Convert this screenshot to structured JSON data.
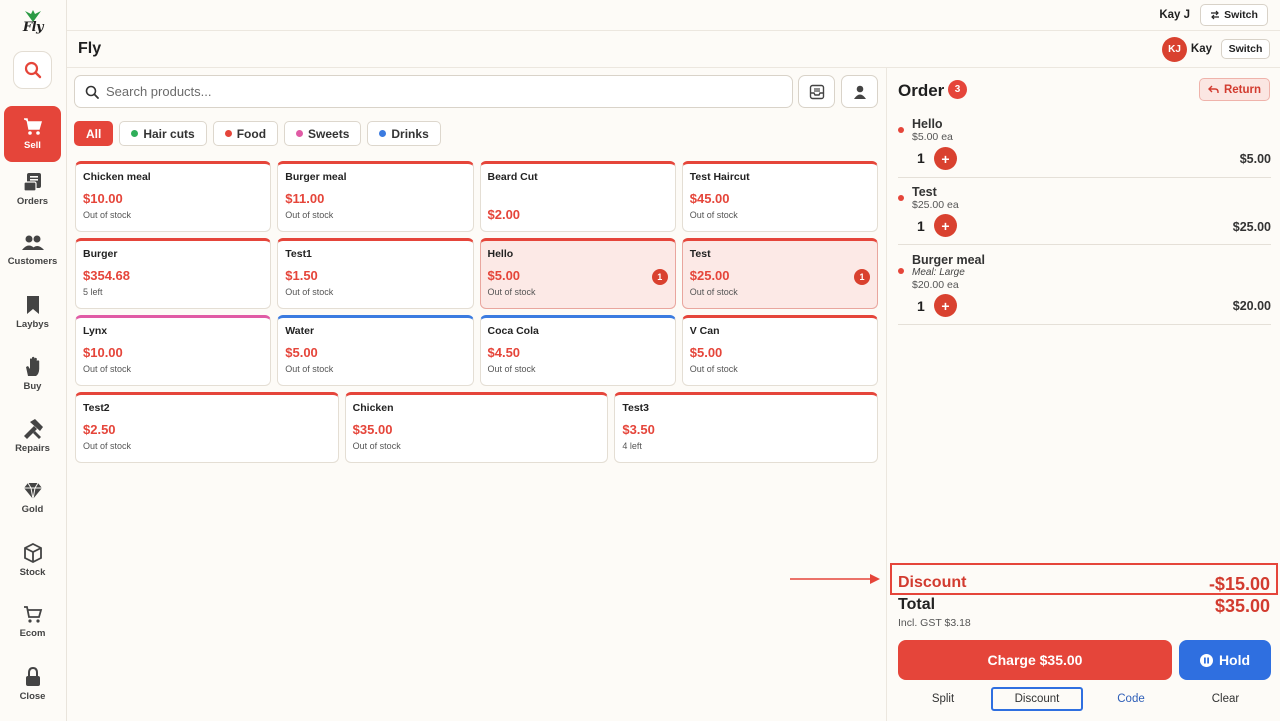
{
  "app": {
    "brand": "Fly",
    "title": "Fly",
    "accent": "#e5453a",
    "blue": "#2f6fe0"
  },
  "topbar": {
    "user_label": "Kay J",
    "switch_label": "Switch"
  },
  "header": {
    "avatar_initials": "KJ",
    "user_name": "Kay",
    "switch_label": "Switch"
  },
  "sidebar": {
    "items": [
      {
        "label": "Sell",
        "icon": "cart-icon",
        "active": true
      },
      {
        "label": "Orders",
        "icon": "orders-icon"
      },
      {
        "label": "Customers",
        "icon": "customers-icon"
      },
      {
        "label": "Laybys",
        "icon": "bookmark-icon"
      },
      {
        "label": "Buy",
        "icon": "hand-icon"
      },
      {
        "label": "Repairs",
        "icon": "tools-icon"
      },
      {
        "label": "Gold",
        "icon": "diamond-icon"
      },
      {
        "label": "Stock",
        "icon": "box-icon"
      },
      {
        "label": "Ecom",
        "icon": "ecom-cart-icon"
      },
      {
        "label": "Close",
        "icon": "lock-icon"
      }
    ]
  },
  "search": {
    "placeholder": "Search products..."
  },
  "categories": [
    {
      "label": "All",
      "active": true
    },
    {
      "label": "Hair cuts",
      "color": "#2fae5a"
    },
    {
      "label": "Food",
      "color": "#e5453a"
    },
    {
      "label": "Sweets",
      "color": "#e05ba5"
    },
    {
      "label": "Drinks",
      "color": "#3b7be0"
    }
  ],
  "products": [
    [
      {
        "name": "Chicken meal",
        "price": "$10.00",
        "stock": "Out of stock",
        "bar": "#e5453a"
      },
      {
        "name": "Burger meal",
        "price": "$11.00",
        "stock": "Out of stock",
        "bar": "#e5453a"
      },
      {
        "name": "Beard Cut",
        "price": "$2.00",
        "stock": "",
        "bar": "#e5453a"
      },
      {
        "name": "Test Haircut",
        "price": "$45.00",
        "stock": "Out of stock",
        "bar": "#e5453a"
      }
    ],
    [
      {
        "name": "Burger",
        "price": "$354.68",
        "stock": "5 left",
        "bar": "#e5453a"
      },
      {
        "name": "Test1",
        "price": "$1.50",
        "stock": "Out of stock",
        "bar": "#e5453a"
      },
      {
        "name": "Hello",
        "price": "$5.00",
        "stock": "Out of stock",
        "bar": "#e5453a",
        "qty": "1"
      },
      {
        "name": "Test",
        "price": "$25.00",
        "stock": "Out of stock",
        "bar": "#e5453a",
        "qty": "1"
      }
    ],
    [
      {
        "name": "Lynx",
        "price": "$10.00",
        "stock": "Out of stock",
        "bar": "#e05ba5"
      },
      {
        "name": "Water",
        "price": "$5.00",
        "stock": "Out of stock",
        "bar": "#3b7be0"
      },
      {
        "name": "Coca Cola",
        "price": "$4.50",
        "stock": "Out of stock",
        "bar": "#3b7be0"
      },
      {
        "name": "V Can",
        "price": "$5.00",
        "stock": "Out of stock",
        "bar": "#e5453a"
      }
    ],
    [
      {
        "name": "Test2",
        "price": "$2.50",
        "stock": "Out of stock",
        "bar": "#e5453a"
      },
      {
        "name": "Chicken",
        "price": "$35.00",
        "stock": "Out of stock",
        "bar": "#e5453a"
      },
      {
        "name": "Test3",
        "price": "$3.50",
        "stock": "4 left",
        "bar": "#e5453a"
      }
    ]
  ],
  "order": {
    "title": "Order",
    "count": "3",
    "return_label": "Return",
    "lines": [
      {
        "name": "Hello",
        "each": "$5.00 ea",
        "qty": "1",
        "total": "$5.00"
      },
      {
        "name": "Test",
        "each": "$25.00 ea",
        "qty": "1",
        "total": "$25.00"
      },
      {
        "name": "Burger meal",
        "modifier": "Meal: Large",
        "each": "$20.00 ea",
        "qty": "1",
        "total": "$20.00"
      }
    ],
    "discount_label": "Discount",
    "discount_value": "-$15.00",
    "total_label": "Total",
    "total_value": "$35.00",
    "gst": "Incl. GST $3.18",
    "charge_label": "Charge $35.00",
    "hold_label": "Hold",
    "footer": {
      "split": "Split",
      "discount": "Discount",
      "code": "Code",
      "clear": "Clear"
    }
  }
}
